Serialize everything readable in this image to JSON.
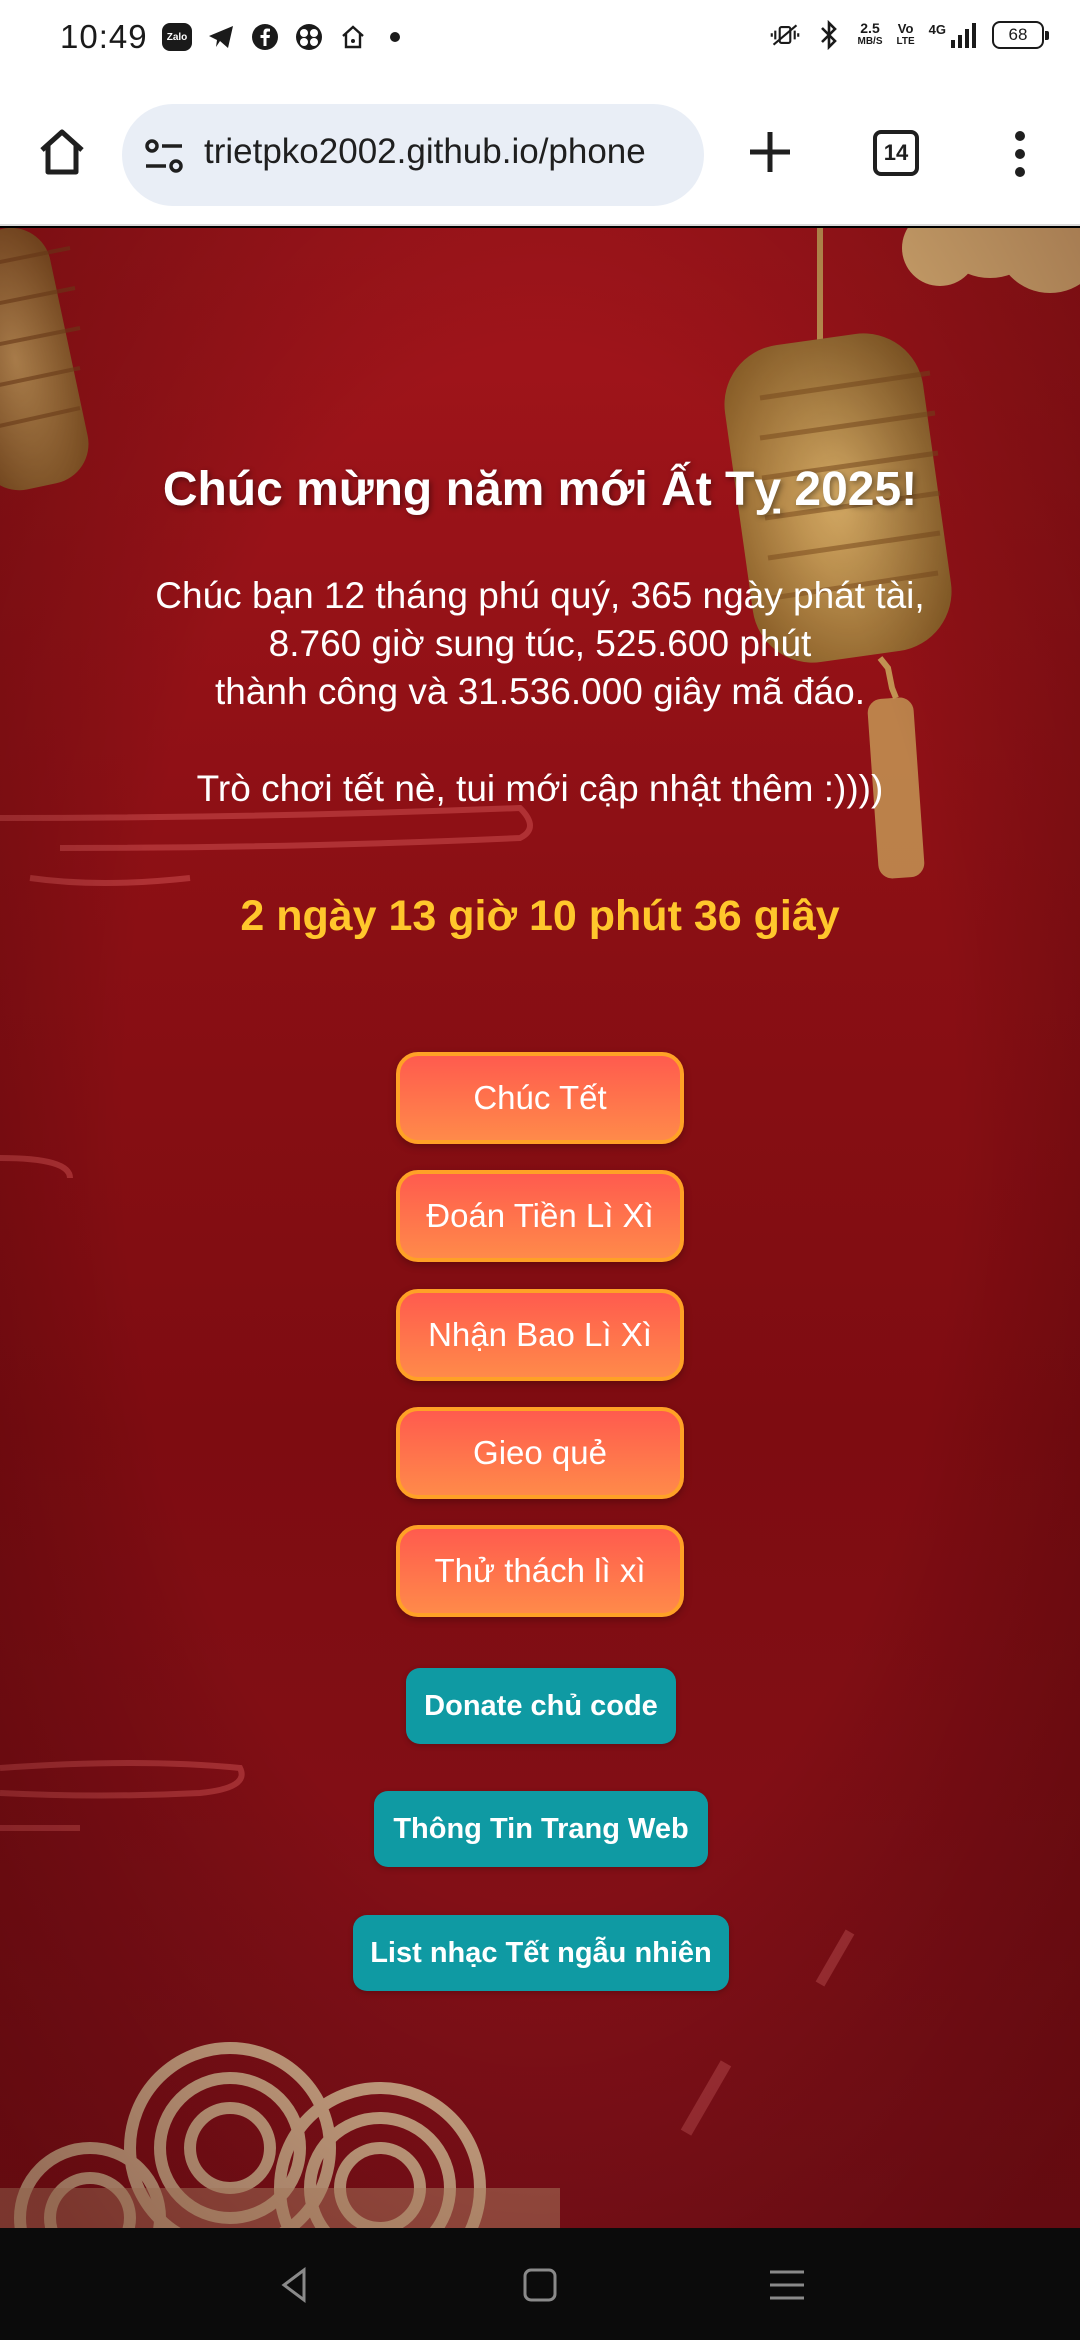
{
  "status_bar": {
    "time": "10:49",
    "zalo_label": "Zalo",
    "net_speed_value": "2.5",
    "net_speed_unit": "MB/S",
    "volte_top": "Vo",
    "volte_bottom": "LTE",
    "network": "4G",
    "battery": "68"
  },
  "browser": {
    "url": "trietpko2002.github.io/phone",
    "tab_count": "14"
  },
  "page": {
    "title": "Chúc mừng năm mới Ất Tỵ 2025!",
    "wish_lines": [
      "Chúc bạn 12 tháng phú quý, 365 ngày phát tài,",
      "8.760 giờ sung túc, 525.600 phút",
      "thành công và 31.536.000 giây mã đáo."
    ],
    "note": "Trò chơi tết nè, tui mới cập nhật thêm :))))",
    "countdown": "2 ngày 13 giờ 10 phút 36 giây",
    "game_buttons": [
      "Chúc Tết",
      "Đoán Tiền Lì Xì",
      "Nhận Bao Lì Xì",
      "Gieo quẻ",
      "Thử thách lì xì"
    ],
    "link_buttons": [
      "Donate chủ code",
      "Thông Tin Trang Web",
      "List nhạc Tết ngẫu nhiên"
    ]
  },
  "colors": {
    "background_red": "#8a0f14",
    "countdown_yellow": "#ffc72c",
    "game_button_orange": "#ff6b4a",
    "link_button_teal": "#0f9aa3"
  }
}
